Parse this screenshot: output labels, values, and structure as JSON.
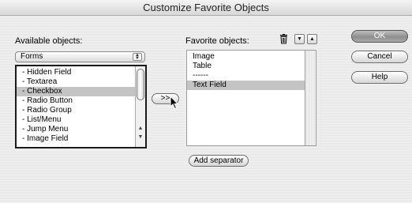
{
  "window": {
    "title": "Customize Favorite Objects"
  },
  "available": {
    "label": "Available objects:",
    "category": "Forms",
    "items": [
      "- Hidden Field",
      "- Textarea",
      "- Checkbox",
      "- Radio Button",
      "- Radio Group",
      "- List/Menu",
      "- Jump Menu",
      "- Image Field"
    ],
    "selected_item": "- Checkbox"
  },
  "favorites": {
    "label": "Favorite objects:",
    "items": [
      "Image",
      "Table",
      "------",
      "Text Field"
    ],
    "selected_item": "Text Field"
  },
  "buttons": {
    "add": ">>",
    "add_separator": "Add separator",
    "ok": "OK",
    "cancel": "Cancel",
    "help": "Help"
  },
  "icons": {
    "delete": "trash-icon",
    "move_down": "arrow-down-icon",
    "move_up": "arrow-up-icon",
    "cursor": "mouse-pointer-icon"
  }
}
